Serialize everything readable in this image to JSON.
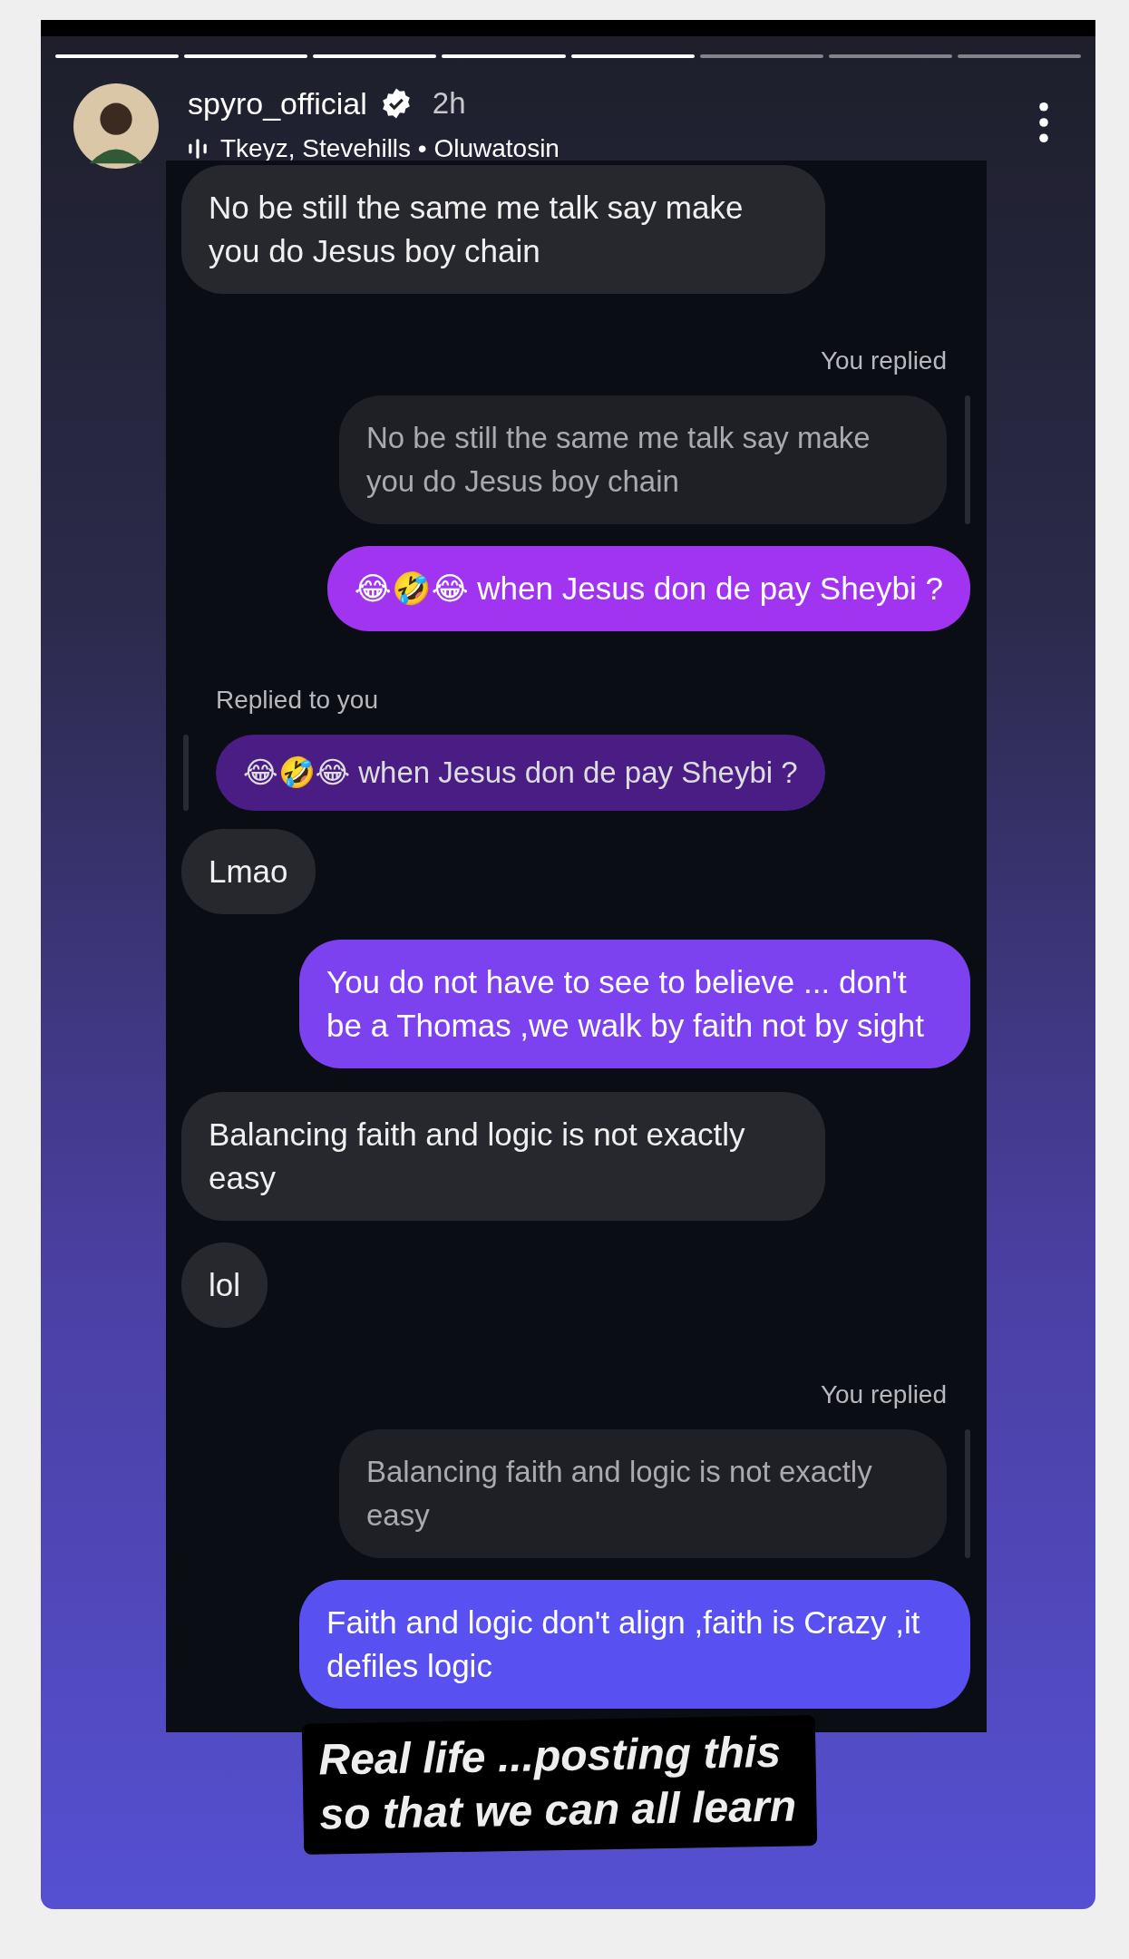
{
  "progress": [
    {
      "seen": true
    },
    {
      "seen": true
    },
    {
      "seen": true
    },
    {
      "seen": true
    },
    {
      "seen": true
    },
    {
      "seen": false
    },
    {
      "seen": false
    },
    {
      "seen": false
    }
  ],
  "header": {
    "username": "spyro_official",
    "verified": true,
    "time": "2h",
    "music": "Tkeyz, Stevehills • Oluwatosin"
  },
  "messages": [
    {
      "kind": "received",
      "text": "No be still the same me talk say make you do Jesus boy chain"
    },
    {
      "kind": "label_right",
      "text": "You replied"
    },
    {
      "kind": "quote_right",
      "text": "No be still the same me talk say make you do Jesus boy chain"
    },
    {
      "kind": "sent",
      "text": "😂🤣😂 when Jesus don de pay Sheybi ?"
    },
    {
      "kind": "label_left",
      "text": "Replied to you"
    },
    {
      "kind": "quote_left",
      "text": "😂🤣😂 when Jesus don de pay Sheybi ?"
    },
    {
      "kind": "received",
      "text": "Lmao"
    },
    {
      "kind": "sent",
      "text": "You do not have to see to believe ... don't be a Thomas ,we walk by faith not by sight"
    },
    {
      "kind": "received",
      "text": "Balancing faith and logic is not exactly easy"
    },
    {
      "kind": "received",
      "text": "lol"
    },
    {
      "kind": "label_right",
      "text": "You replied"
    },
    {
      "kind": "quote_right",
      "text": "Balancing faith and logic is not exactly easy"
    },
    {
      "kind": "sent",
      "text": "Faith and logic don't align ,faith is Crazy ,it defiles logic"
    }
  ],
  "caption": {
    "lines": [
      "Real life ...posting this",
      "so that we can all learn"
    ]
  }
}
